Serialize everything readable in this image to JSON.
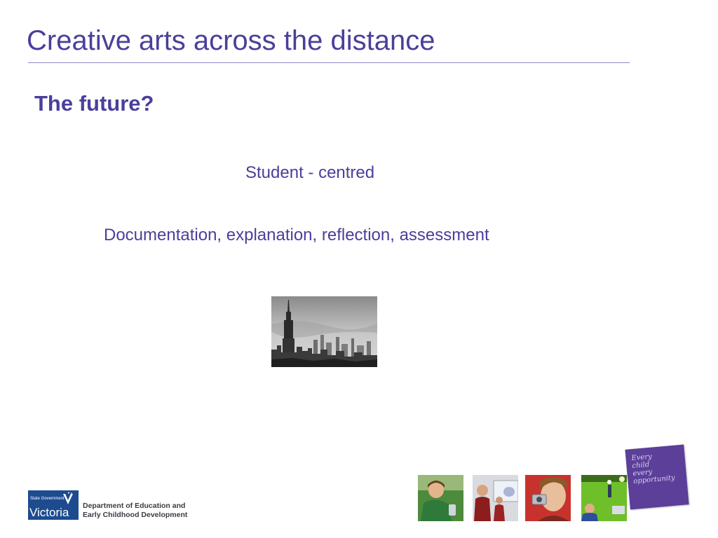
{
  "slide": {
    "title": "Creative arts across the distance",
    "subtitle": "The future?",
    "line1": "Student - centred",
    "line2": "Documentation, explanation, reflection, assessment"
  },
  "footer": {
    "logo_top": "State Government",
    "logo_main": "Victoria",
    "dept_line1": "Department of Education and",
    "dept_line2": "Early Childhood Development",
    "tagline": [
      "Every",
      "child",
      "every",
      "opportunity"
    ]
  },
  "colors": {
    "accent": "#4a3f9a",
    "logo_blue": "#1d4b8f",
    "tagline_bg": "#5b3f99"
  }
}
